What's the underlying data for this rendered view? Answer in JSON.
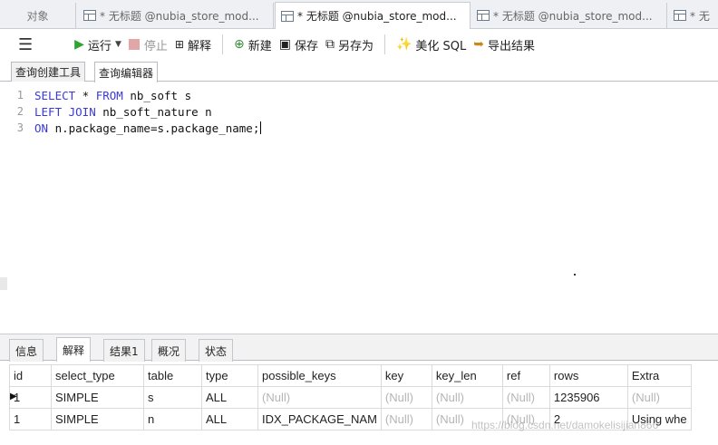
{
  "doc_tabs": [
    {
      "label": "对象"
    },
    {
      "label": "* 无标题 @nubia_store_mod..."
    },
    {
      "label": "* 无标题 @nubia_store_mod..."
    },
    {
      "label": "* 无标题 @nubia_store_mod..."
    },
    {
      "label": "* 无"
    }
  ],
  "toolbar": {
    "run": "运行",
    "stop": "停止",
    "explain": "解释",
    "new": "新建",
    "save": "保存",
    "save_as": "另存为",
    "beautify": "美化 SQL",
    "export": "导出结果"
  },
  "sub_tabs": [
    "查询创建工具",
    "查询编辑器"
  ],
  "editor": {
    "lines": [
      {
        "n": "1",
        "kw1": "SELECT",
        "t1": " * ",
        "kw2": "FROM",
        "t2": " nb_soft s"
      },
      {
        "n": "2",
        "kw1": "LEFT JOIN",
        "t1": " nb_soft_nature n",
        "kw2": "",
        "t2": ""
      },
      {
        "n": "3",
        "kw1": "ON",
        "t1": " n.package_name=s.package_name;",
        "kw2": "",
        "t2": ""
      }
    ]
  },
  "bottom_tabs": [
    "信息",
    "解释",
    "结果1",
    "概况",
    "状态"
  ],
  "grid": {
    "columns": [
      "id",
      "select_type",
      "table",
      "type",
      "possible_keys",
      "key",
      "key_len",
      "ref",
      "rows",
      "Extra"
    ],
    "rows": [
      [
        "1",
        "SIMPLE",
        "s",
        "ALL",
        "(Null)",
        "(Null)",
        "(Null)",
        "(Null)",
        "1235906",
        "(Null)"
      ],
      [
        "1",
        "SIMPLE",
        "n",
        "ALL",
        "IDX_PACKAGE_NAM",
        "(Null)",
        "(Null)",
        "(Null)",
        "2",
        "Using whe"
      ]
    ]
  },
  "watermark": "https://blog.csdn.net/damokelisijian866"
}
